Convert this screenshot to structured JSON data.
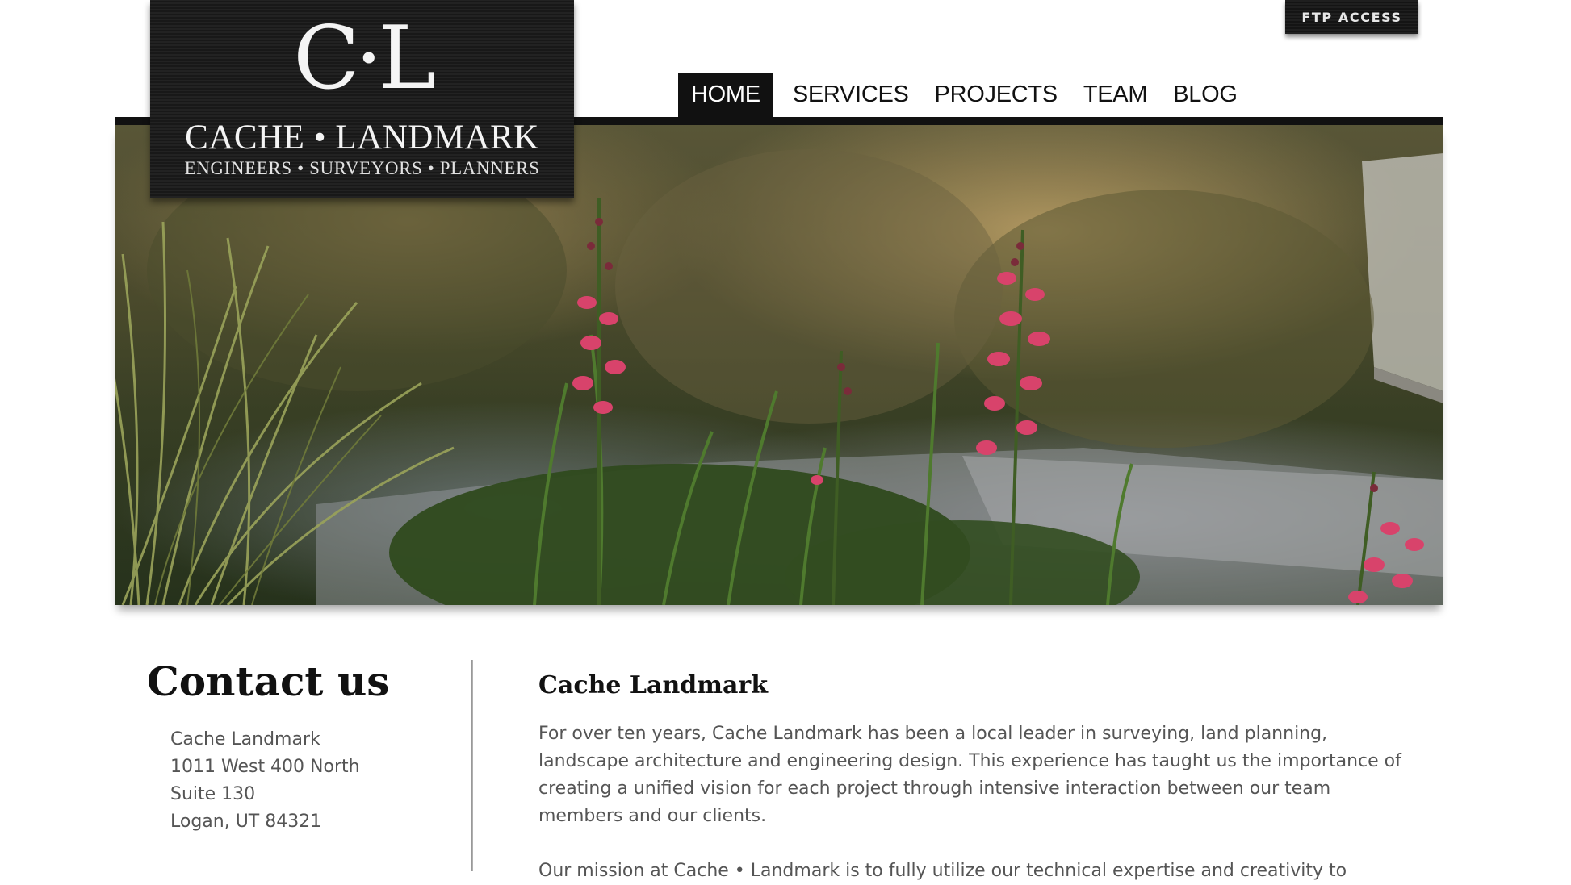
{
  "ftp": {
    "label": "FTP ACCESS"
  },
  "logo": {
    "mark": "C·L",
    "name": "CACHE • LANDMARK",
    "tagline": "ENGINEERS • SURVEYORS • PLANNERS"
  },
  "nav": {
    "items": [
      {
        "label": "HOME",
        "active": true
      },
      {
        "label": "SERVICES"
      },
      {
        "label": "PROJECTS"
      },
      {
        "label": "TEAM"
      },
      {
        "label": "BLOG"
      }
    ]
  },
  "hero": {
    "subject": "flowering penstemon and ornamental grasses beside a paved path"
  },
  "contact": {
    "title": "Contact us",
    "address": [
      "Cache Landmark",
      "1011 West 400 North",
      "Suite 130",
      "Logan, UT 84321"
    ]
  },
  "main": {
    "title": "Cache Landmark",
    "paragraph1": "For over ten years, Cache Landmark has been a local leader in surveying, land planning, landscape architecture and engineering design. This experience has taught us the importance of creating a unified vision for each project through intensive interaction between our team members and our clients.",
    "paragraph2": "Our mission at Cache • Landmark is to fully utilize our technical expertise and creativity to"
  },
  "colors": {
    "dark": "#111111",
    "text": "#555555",
    "flower": "#d8436b"
  }
}
